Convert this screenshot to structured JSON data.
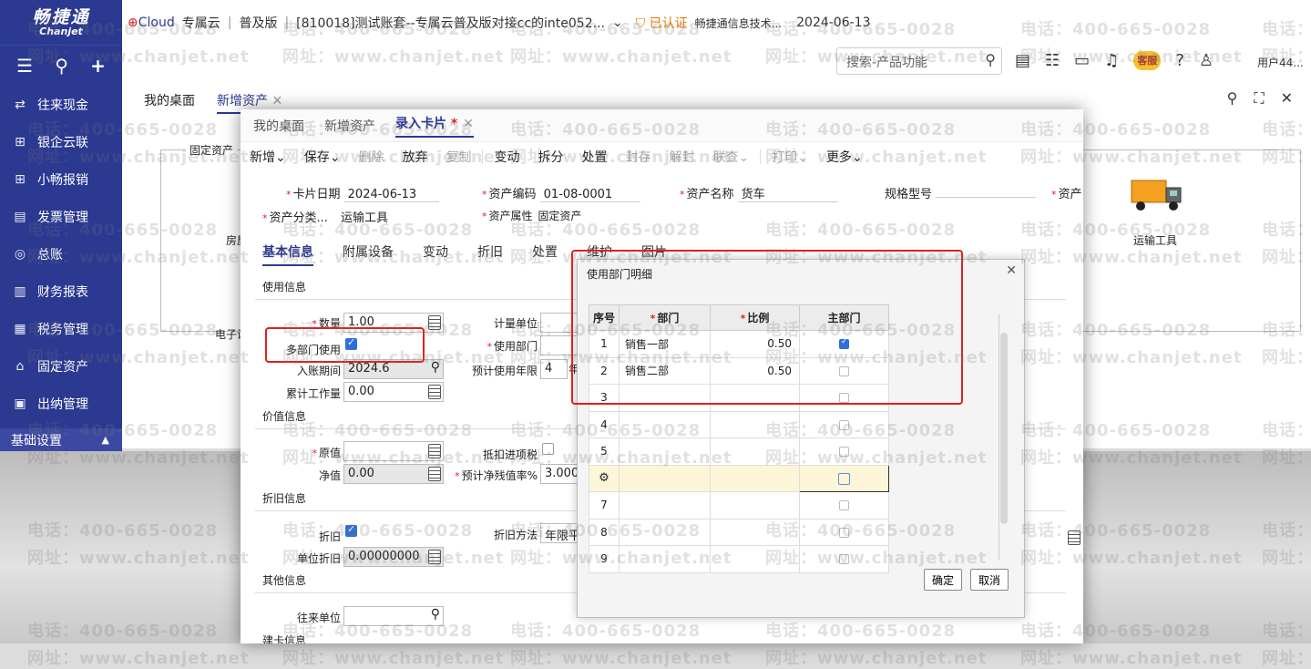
{
  "brand": {
    "name_cn": "畅捷通",
    "name_en": "Chanjet"
  },
  "topbar": {
    "cloud_logo": "Cloud",
    "product": "专属云",
    "edition": "普及版",
    "account": "[810018]测试账套--专属云普及版对接cc的inte052...",
    "certified": "已认证",
    "company": "畅捷通信息技术...",
    "date": "2024-06-13",
    "search_placeholder": "搜索-产品功能",
    "service_badge": "客服",
    "user": "用户44..."
  },
  "sidebar": {
    "items": [
      {
        "label": "往来现金",
        "icon": "transfer-icon"
      },
      {
        "label": "银企云联",
        "icon": "grid-icon"
      },
      {
        "label": "小畅报销",
        "icon": "grid-icon"
      },
      {
        "label": "发票管理",
        "icon": "invoice-icon"
      },
      {
        "label": "总账",
        "icon": "ledger-icon"
      },
      {
        "label": "财务报表",
        "icon": "report-icon"
      },
      {
        "label": "税务管理",
        "icon": "tax-icon"
      },
      {
        "label": "固定资产",
        "icon": "bank-icon"
      },
      {
        "label": "出纳管理",
        "icon": "cashier-icon"
      }
    ],
    "footer": "基础设置"
  },
  "bg_page": {
    "tabs": [
      "我的桌面",
      "新增资产"
    ],
    "group_label": "固定资产",
    "house_label": "房屋",
    "pc_label": "电子设",
    "truck_label": "运输工具"
  },
  "card": {
    "tabs": [
      "我的桌面",
      "新增资产",
      "录入卡片"
    ],
    "active_tab_star": "*",
    "menu": {
      "new": "新增",
      "save": "保存",
      "delete": "删除",
      "discard": "放弃",
      "copy": "复制",
      "change": "变动",
      "split": "拆分",
      "dispose": "处置",
      "seal": "封存",
      "unseal": "解封",
      "link": "联查",
      "print": "打印",
      "more": "更多"
    },
    "header": {
      "card_date_label": "卡片日期",
      "card_date": "2024-06-13",
      "asset_code_label": "资产编码",
      "asset_code": "01-08-0001",
      "asset_name_label": "资产名称",
      "asset_name": "货车",
      "spec_label": "规格型号",
      "spec": "",
      "asset_more_label": "资产",
      "category_label": "资产分类...",
      "category": "运输工具",
      "attr_label": "资产属性",
      "attr": "固定资产"
    },
    "subtabs": [
      "基本信息",
      "附属设备",
      "变动",
      "折旧",
      "处置",
      "维护",
      "图片"
    ],
    "usage": {
      "section": "使用信息",
      "qty_label": "数量",
      "qty": "1.00",
      "unit_label": "计量单位",
      "multi_dept_label": "多部门使用",
      "dept_label": "使用部门",
      "period_label": "入账期间",
      "period": "2024.6",
      "life_label": "预计使用年限",
      "life": "4",
      "life_unit": "年",
      "workload_label": "累计工作量",
      "workload": "0.00"
    },
    "value": {
      "section": "价值信息",
      "orig_label": "原值",
      "orig": "",
      "deduct_label": "抵扣进项税",
      "net_label": "净值",
      "net": "0.00",
      "residual_label": "预计净残值率%",
      "residual": "3.0000"
    },
    "depr": {
      "section": "折旧信息",
      "depr_label": "折旧",
      "method_label": "折旧方法",
      "method": "年限平",
      "unit_depr_label": "单位折旧",
      "unit_depr": "0.00000000"
    },
    "other": {
      "section": "其他信息",
      "partner_label": "往来单位",
      "build_label": "建卡信息"
    }
  },
  "dialog": {
    "title": "使用部门明细",
    "columns": [
      "序号",
      "部门",
      "比例",
      "主部门"
    ],
    "rows": [
      {
        "no": "1",
        "dept": "销售一部",
        "ratio": "0.50",
        "main": true
      },
      {
        "no": "2",
        "dept": "销售二部",
        "ratio": "0.50",
        "main": false
      },
      {
        "no": "3",
        "dept": "",
        "ratio": "",
        "main": false
      },
      {
        "no": "4",
        "dept": "",
        "ratio": "",
        "main": false
      },
      {
        "no": "5",
        "dept": "",
        "ratio": "",
        "main": false
      },
      {
        "no": "",
        "dept": "",
        "ratio": "",
        "main": false
      },
      {
        "no": "7",
        "dept": "",
        "ratio": "",
        "main": false
      },
      {
        "no": "8",
        "dept": "",
        "ratio": "",
        "main": false
      },
      {
        "no": "9",
        "dept": "",
        "ratio": "",
        "main": false
      }
    ],
    "ok": "确定",
    "cancel": "取消"
  },
  "watermark": {
    "phone": "电话：400-665-0028",
    "site": "网址：www.chanjet.net"
  },
  "colors": {
    "sidebar": "#2b3991",
    "accent": "#2b3991",
    "highlight": "#e02020"
  }
}
